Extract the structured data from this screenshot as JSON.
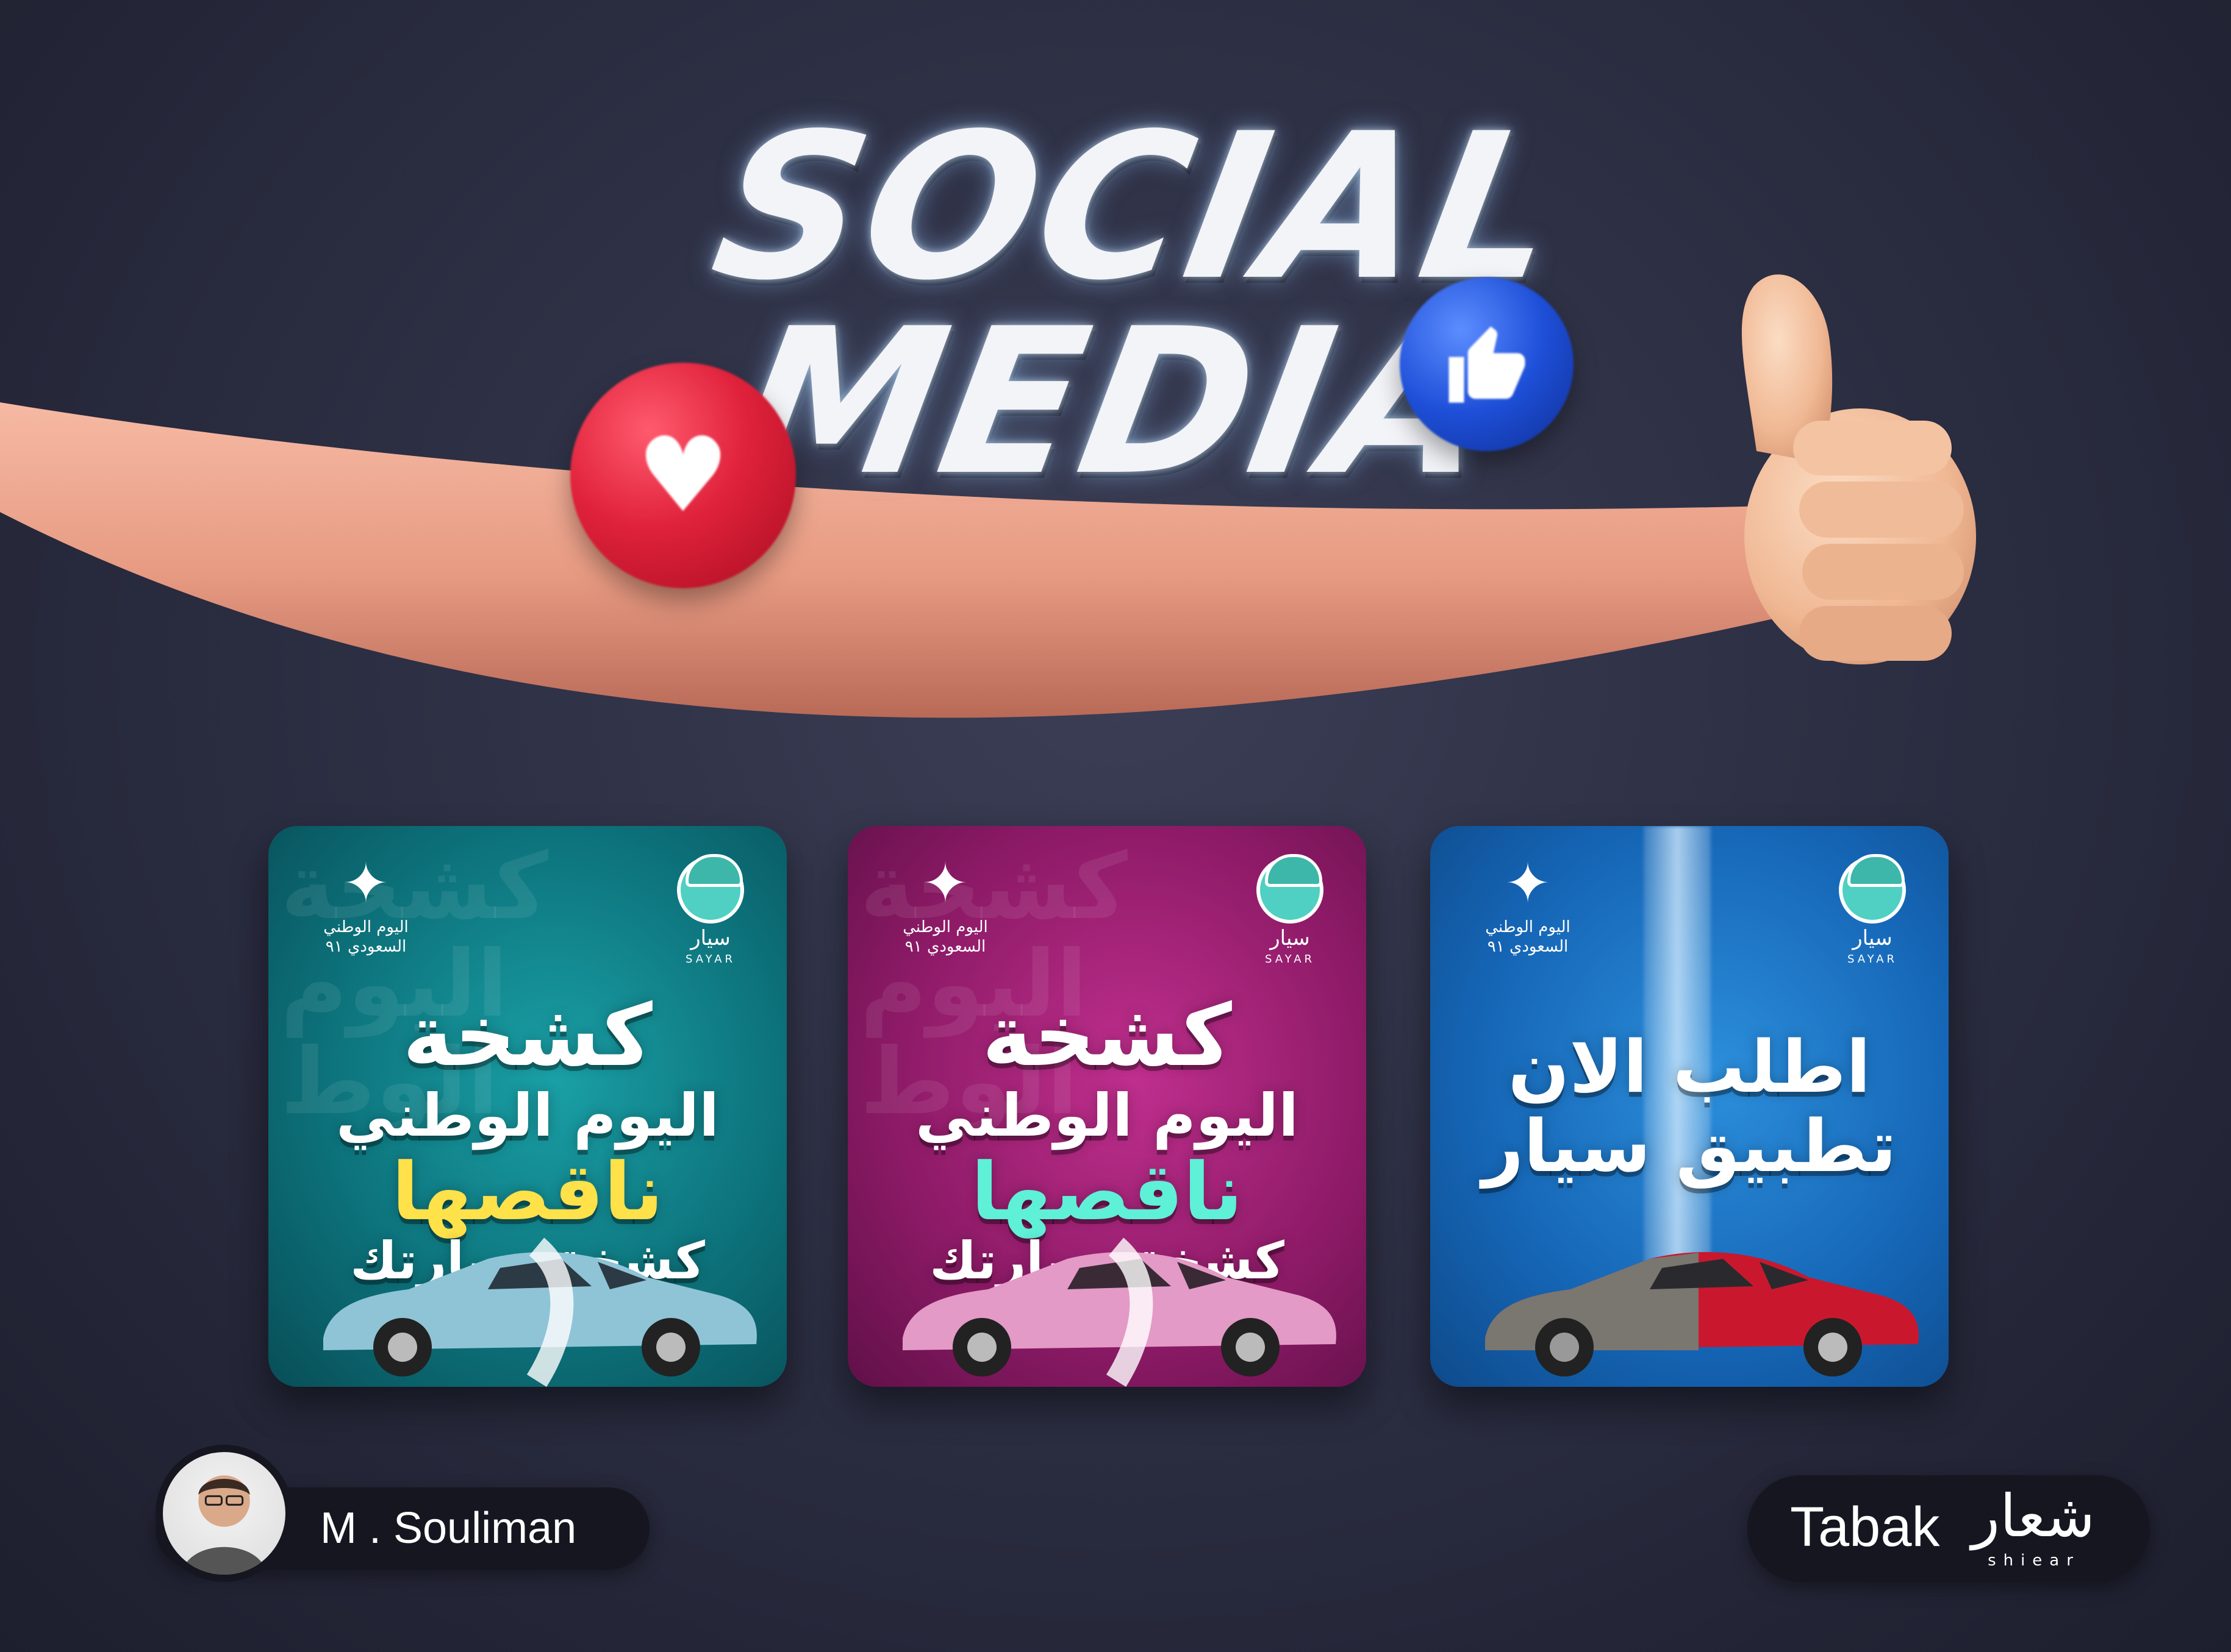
{
  "hero": {
    "title_line1": "SOCIAL",
    "title_line2": "MEDIA",
    "heart_icon": "heart-icon",
    "like_icon": "thumbs-up-icon"
  },
  "cards": [
    {
      "theme": "teal",
      "watermark": "كشخة اليوم الوط",
      "logo_national_label": "اليوم الوطني السعودي ٩١",
      "logo_brand_ar": "سيار",
      "logo_brand_en": "SAYAR",
      "line1": "كشخة",
      "line2": "اليوم الوطني",
      "line3": "ناقصها",
      "line4": "كشخة سيارتك"
    },
    {
      "theme": "pink",
      "watermark": "كشخة اليوم الوط",
      "logo_national_label": "اليوم الوطني السعودي ٩١",
      "logo_brand_ar": "سيار",
      "logo_brand_en": "SAYAR",
      "line1": "كشخة",
      "line2": "اليوم الوطني",
      "line3": "ناقصها",
      "line4": "كشخة سيارتك"
    },
    {
      "theme": "blue",
      "logo_national_label": "اليوم الوطني السعودي ٩١",
      "logo_brand_ar": "سيار",
      "logo_brand_en": "SAYAR",
      "line1": "اطلب الان",
      "line2": "تطبيق سيار"
    }
  ],
  "author": {
    "name": "M . Souliman"
  },
  "brands": {
    "tabak": "Tabak",
    "shiear_ar": "شعار",
    "shiear_en": "shiear"
  },
  "colors": {
    "background": "#2a2c40",
    "teal_card": "#0c6f78",
    "pink_card": "#8c1a66",
    "blue_card": "#1565b5",
    "heart_red": "#e0223b",
    "like_blue": "#1e4fd8"
  }
}
